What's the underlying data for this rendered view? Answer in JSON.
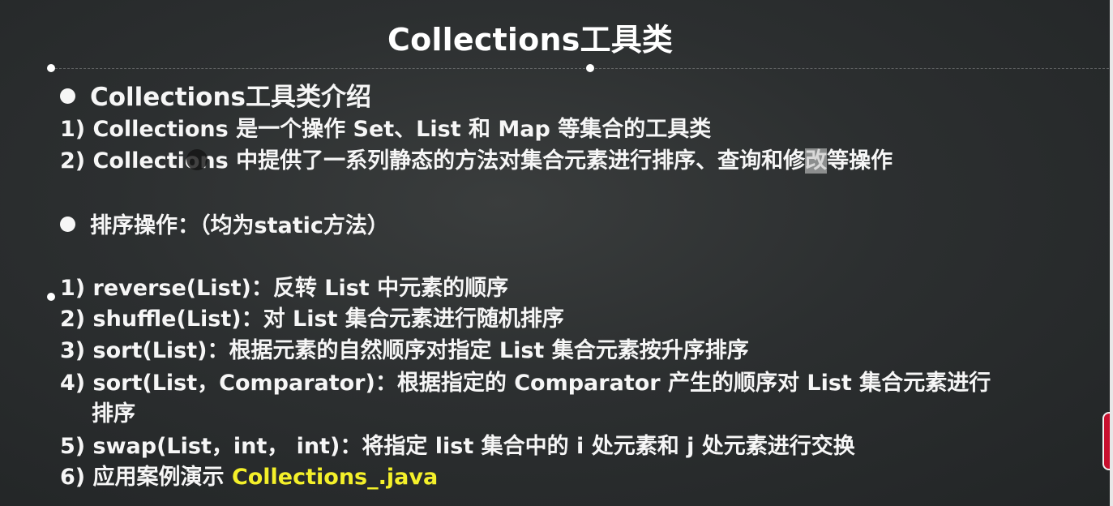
{
  "slide": {
    "title": "Collections工具类",
    "section1": {
      "heading": "Collections工具类介绍",
      "items": [
        "1) Collections 是一个操作 Set、List 和 Map 等集合的工具类",
        "2) Collections 中提供了一系列静态的方法对集合元素进行排序、查询和修",
        "改",
        "等操作"
      ]
    },
    "section2": {
      "heading": "排序操作：（均为static方法）",
      "items": [
        "1) reverse(List)：反转 List 中元素的顺序",
        "2) shuffle(List)：对 List 集合元素进行随机排序",
        "3) sort(List)：根据元素的自然顺序对指定 List 集合元素按升序排序",
        "4) sort(List，Comparator)：根据指定的 Comparator 产生的顺序对 List 集合元素进行",
        "排序",
        "5) swap(List，int， int)：将指定 list 集合中的 i 处元素和 j 处元素进行交换",
        "6) 应用案例演示 ",
        "Collections_.java"
      ]
    }
  },
  "colors": {
    "background": "#2c2f30",
    "text": "#f6f6f6",
    "accent_yellow": "#f4f02a"
  }
}
